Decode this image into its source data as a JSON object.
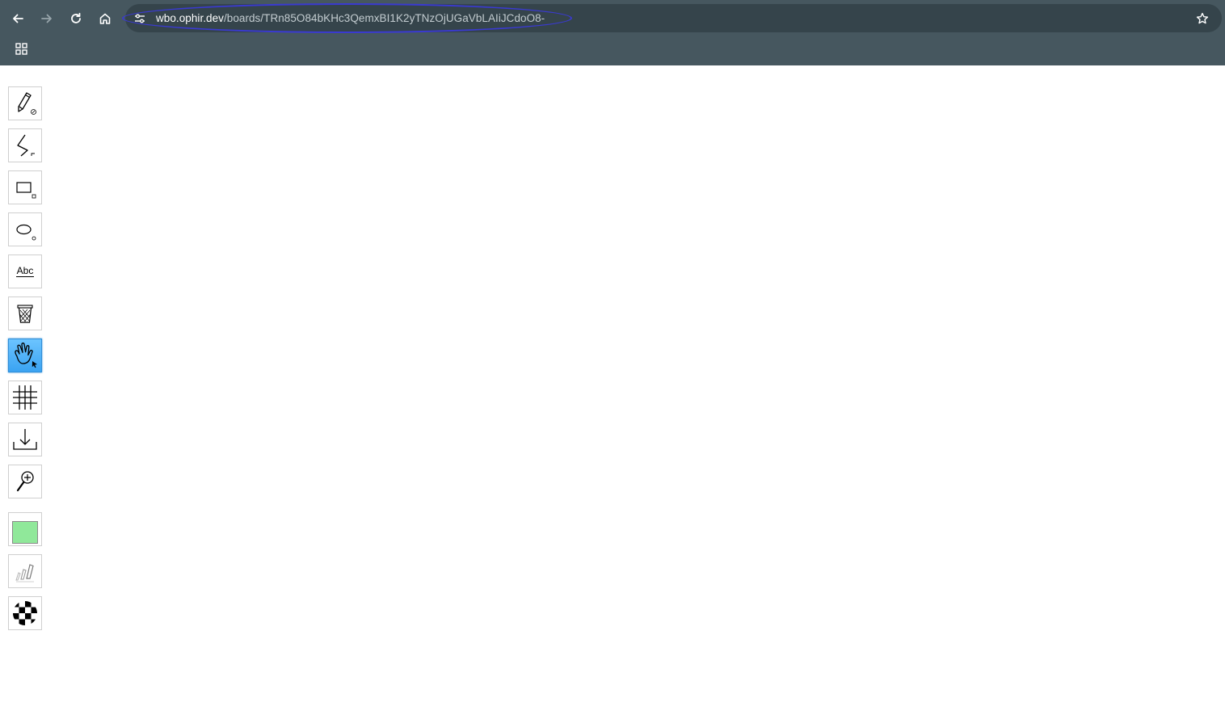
{
  "browser": {
    "url_host": "wbo.ophir.dev",
    "url_path": "/boards/TRn85O84bKHc3QemxBI1K2yTNzOjUGaVbLAIiJCdoO8-"
  },
  "toolbar": {
    "text_tool_label": "Abc",
    "active_tool": "hand",
    "current_color": "#90e89a",
    "tools": [
      {
        "name": "pencil",
        "icon": "pencil-icon"
      },
      {
        "name": "line",
        "icon": "line-icon"
      },
      {
        "name": "rectangle",
        "icon": "rectangle-icon"
      },
      {
        "name": "ellipse",
        "icon": "ellipse-icon"
      },
      {
        "name": "text",
        "icon": "text-icon"
      },
      {
        "name": "eraser",
        "icon": "eraser-icon"
      },
      {
        "name": "hand",
        "icon": "hand-icon"
      },
      {
        "name": "grid",
        "icon": "grid-icon"
      },
      {
        "name": "download",
        "icon": "download-icon"
      },
      {
        "name": "zoom",
        "icon": "zoom-icon"
      },
      {
        "name": "color",
        "icon": "color-swatch"
      },
      {
        "name": "size",
        "icon": "pencil-size-icon"
      },
      {
        "name": "opacity",
        "icon": "opacity-icon"
      }
    ]
  },
  "colors": {
    "chrome_bg": "#46575f",
    "omnibox_bg": "#35444b",
    "highlight": "#3a3ad0",
    "active_tool": "#3aa3f2"
  }
}
